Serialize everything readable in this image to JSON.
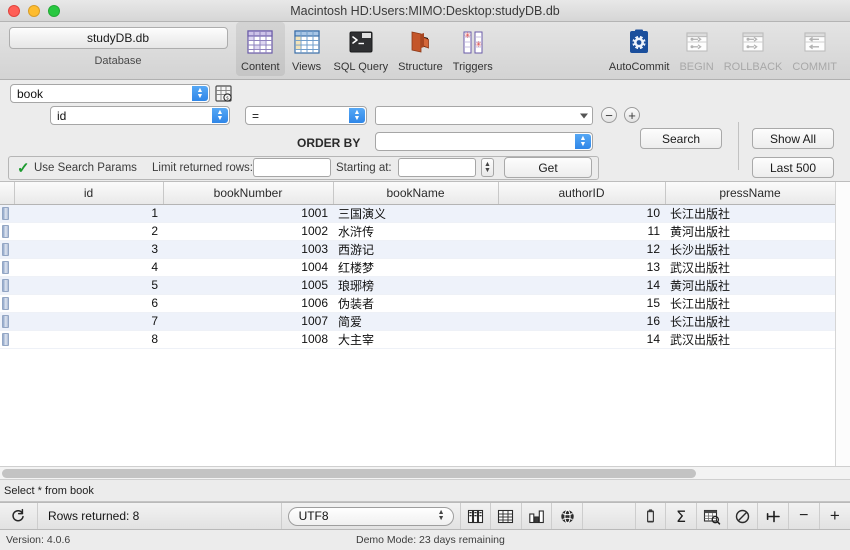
{
  "window": {
    "title": "Macintosh HD:Users:MIMO:Desktop:studyDB.db",
    "close_label": "close",
    "minimize_label": "minimize",
    "zoom_label": "zoom"
  },
  "toolbar": {
    "database_button": "studyDB.db",
    "database_caption": "Database",
    "items": [
      {
        "label": "Content",
        "icon": "grid-purple-icon",
        "selected": true,
        "enabled": true
      },
      {
        "label": "Views",
        "icon": "grid-blue-icon",
        "selected": false,
        "enabled": true
      },
      {
        "label": "SQL Query",
        "icon": "terminal-icon",
        "selected": false,
        "enabled": true
      },
      {
        "label": "Structure",
        "icon": "folder-open-icon",
        "selected": false,
        "enabled": true
      },
      {
        "label": "Triggers",
        "icon": "triggers-icon",
        "selected": false,
        "enabled": true
      }
    ],
    "right_items": [
      {
        "label": "AutoCommit",
        "icon": "autocommit-gear-icon",
        "enabled": true
      },
      {
        "label": "BEGIN",
        "icon": "begin-icon",
        "enabled": false
      },
      {
        "label": "ROLLBACK",
        "icon": "rollback-icon",
        "enabled": false
      },
      {
        "label": "COMMIT",
        "icon": "commit-icon",
        "enabled": false
      }
    ]
  },
  "filters": {
    "table_select_value": "book",
    "table_tool_icon": "table-properties-icon",
    "column_select_value": "id",
    "operator_select_value": "=",
    "value_combo_value": "",
    "remove_filter_label": "−",
    "add_filter_label": "+",
    "order_by_label": "ORDER BY",
    "order_by_value": "",
    "use_search_params_label": "Use Search Params",
    "use_search_params_checked": true,
    "limit_label": "Limit returned rows:",
    "limit_value": "",
    "starting_label": "Starting at:",
    "starting_value": "",
    "get_button": "Get",
    "search_button": "Search",
    "show_all_button": "Show All",
    "last_500_button": "Last 500"
  },
  "grid": {
    "columns": [
      "id",
      "bookNumber",
      "bookName",
      "authorID",
      "pressName"
    ],
    "column_align": [
      "num",
      "num",
      "txt",
      "num",
      "txt"
    ],
    "rows": [
      [
        "1",
        "1001",
        "三国演义",
        "10",
        "长江出版社"
      ],
      [
        "2",
        "1002",
        "水浒传",
        "11",
        "黄河出版社"
      ],
      [
        "3",
        "1003",
        "西游记",
        "12",
        "长沙出版社"
      ],
      [
        "4",
        "1004",
        "红楼梦",
        "13",
        "武汉出版社"
      ],
      [
        "5",
        "1005",
        "琅琊榜",
        "14",
        "黄河出版社"
      ],
      [
        "6",
        "1006",
        "伪装者",
        "15",
        "长江出版社"
      ],
      [
        "7",
        "1007",
        "简爱",
        "16",
        "长江出版社"
      ],
      [
        "8",
        "1008",
        "大主宰",
        "14",
        "武汉出版社"
      ]
    ]
  },
  "sql_status": "Select * from book",
  "status": {
    "refresh_icon": "refresh-icon",
    "rows_returned": "Rows returned: 8",
    "encoding_value": "UTF8",
    "icons": [
      "columns-icon",
      "table-icon",
      "chart-icon",
      "globe-icon",
      "clipboard-icon",
      "sum-sigma-icon",
      "table-search-icon",
      "no-entry-icon",
      "add-row-icon",
      "remove-row-icon",
      "plus-icon"
    ]
  },
  "footer": {
    "version": "Version: 4.0.6",
    "demo_mode": "Demo Mode: 23 days remaining"
  }
}
